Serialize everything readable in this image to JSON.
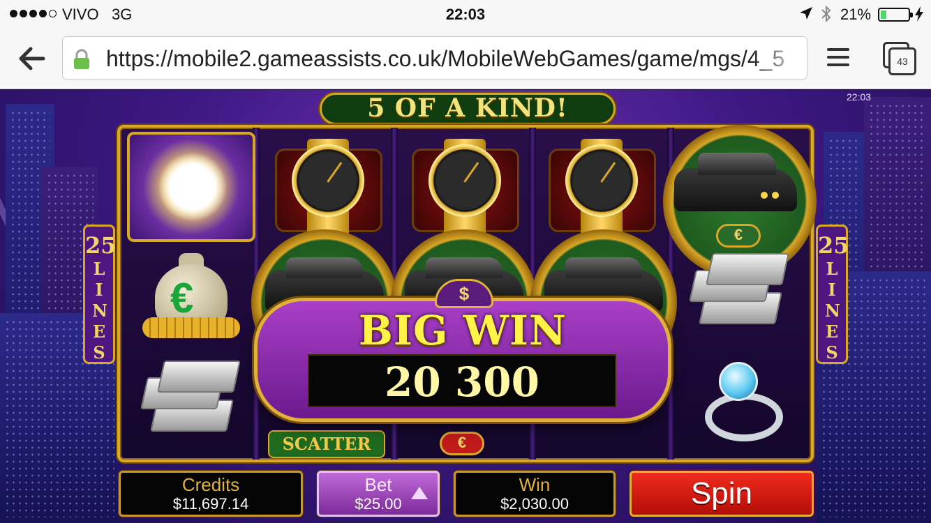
{
  "status_bar": {
    "carrier": "VIVO",
    "network": "3G",
    "time": "22:03",
    "battery_percent": "21%",
    "battery_level": 0.21,
    "signal_bars": 4
  },
  "browser": {
    "url": "https://mobile2.gameassists.co.uk/MobileWebGames/game/mgs/4_5",
    "tab_count": "43",
    "icons": {
      "back": "back-arrow-icon",
      "lock": "lock-icon",
      "menu": "hamburger-menu-icon",
      "tabs": "tabs-icon"
    }
  },
  "game": {
    "clock": "22:03",
    "banner": "5 OF A KIND!",
    "lines_left": {
      "number": "25",
      "word": "LINES"
    },
    "lines_right": {
      "number": "25",
      "word": "LINES"
    },
    "big_win": {
      "title": "BIG WIN",
      "amount": "20 300"
    },
    "symbols": {
      "scatter_label": "SCATTER",
      "euro": "€"
    },
    "controls": {
      "credits_label": "Credits",
      "credits_value": "$11,697.14",
      "bet_label": "Bet",
      "bet_value": "$25.00",
      "win_label": "Win",
      "win_value": "$2,030.00",
      "spin_label": "Spin"
    },
    "colors": {
      "accent_gold": "#d9a827",
      "big_win_text": "#fff34a",
      "spin_red": "#d41a10",
      "bet_purple": "#a14dbf"
    }
  }
}
